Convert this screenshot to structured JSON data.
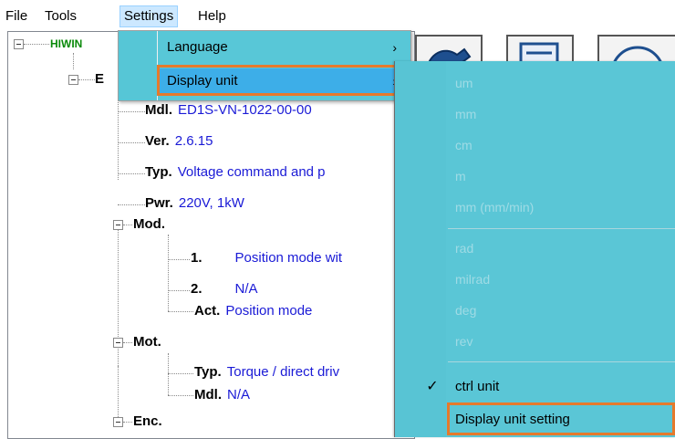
{
  "menubar": {
    "file": "File",
    "tools": "Tools",
    "settings": "Settings",
    "help": "Help"
  },
  "tree": {
    "root": "HIWIN",
    "child": "E",
    "items": [
      {
        "key": "Mdl.",
        "value": "ED1S-VN-1022-00-00"
      },
      {
        "key": "Ver.",
        "value": "2.6.15"
      },
      {
        "key": "Typ.",
        "value": "Voltage command and p"
      },
      {
        "key": "Pwr.",
        "value": "220V, 1kW"
      }
    ],
    "mod": {
      "label": "Mod.",
      "items": [
        {
          "key": "1.",
          "value": "Position mode wit"
        },
        {
          "key": "2.",
          "value": "N/A"
        },
        {
          "key": "Act.",
          "value": "Position mode"
        }
      ]
    },
    "mot": {
      "label": "Mot.",
      "items": [
        {
          "key": "Typ.",
          "value": "Torque / direct driv"
        },
        {
          "key": "Mdl.",
          "value": "N/A"
        }
      ]
    },
    "enc": {
      "label": "Enc."
    }
  },
  "settings_menu": {
    "items": [
      {
        "label": "Language",
        "arrow": "›"
      },
      {
        "label": "Display unit",
        "arrow": "›"
      }
    ]
  },
  "display_unit_menu": {
    "group1": [
      "um",
      "mm",
      "cm",
      "m",
      "mm (mm/min)"
    ],
    "group2": [
      "rad",
      "milrad",
      "deg",
      "rev"
    ],
    "ctrl_unit": "ctrl unit",
    "check": "✓",
    "display_unit_setting": "Display unit setting"
  },
  "colors": {
    "menu_bg": "#58c7d7",
    "menu_highlight": "#3daee8",
    "annotation_outline": "#e57a2c",
    "tree_value": "#1a1ad6"
  }
}
